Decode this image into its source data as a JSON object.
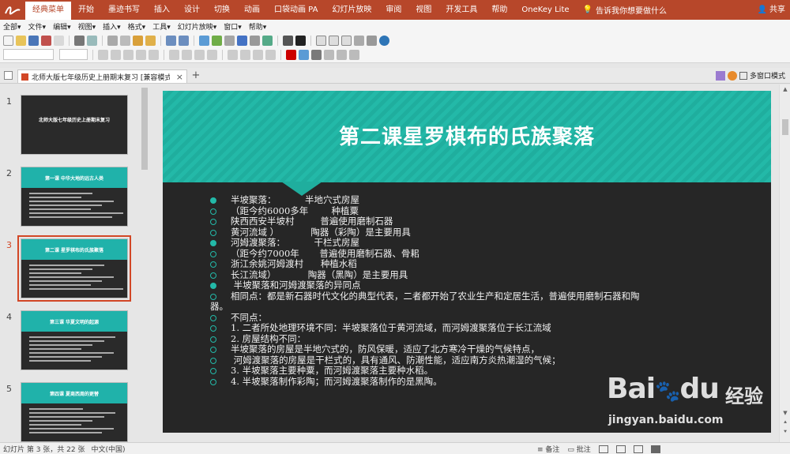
{
  "ribbon": {
    "tabs": [
      "经典菜单",
      "开始",
      "墨迹书写",
      "插入",
      "设计",
      "切换",
      "动画",
      "口袋动画 PA",
      "幻灯片放映",
      "审阅",
      "视图",
      "开发工具",
      "帮助",
      "OneKey Lite"
    ],
    "active_tab": "经典菜单",
    "tell_me": "告诉我你想要做什么",
    "share": "共享",
    "accent": "#b7472a"
  },
  "menu": {
    "items": [
      "全部▾",
      "文件▾",
      "编辑▾",
      "视图▾",
      "插入▾",
      "格式▾",
      "工具▾",
      "幻灯片放映▾",
      "窗口▾",
      "帮助▾"
    ]
  },
  "doc_tab": {
    "title": "北师大版七年级历史上册期末复习 [兼容模式",
    "close": "×",
    "plus": "+",
    "multi_window": "多窗口模式"
  },
  "thumbnails": [
    {
      "num": "1",
      "title": "北师大版七年级历史上册期末复习"
    },
    {
      "num": "2",
      "title": "第一课 中华大地的远古人类"
    },
    {
      "num": "3",
      "title": "第二课 星罗棋布的氏族聚落"
    },
    {
      "num": "4",
      "title": "第三课 华夏文明的起源"
    },
    {
      "num": "5",
      "title": "第四课 夏商西周的更替"
    }
  ],
  "slide": {
    "title": "第二课星罗棋布的氏族聚落",
    "accent": "#23b9a8",
    "lines": [
      {
        "bullet": "filled",
        "text": "半坡聚落：          半地穴式房屋"
      },
      {
        "bullet": "hollow",
        "text": "（距今约6000多年        种植粟"
      },
      {
        "bullet": "hollow",
        "text": "陕西西安半坡村         普遍使用磨制石器"
      },
      {
        "bullet": "hollow",
        "text": "黄河流域 ）           陶器（彩陶）是主要用具"
      },
      {
        "bullet": "filled",
        "text": "河姆渡聚落：          干栏式房屋"
      },
      {
        "bullet": "hollow",
        "text": "（距今约7000年       普遍使用磨制石器、骨耜"
      },
      {
        "bullet": "hollow",
        "text": "浙江余姚河姆渡村      种植水稻"
      },
      {
        "bullet": "hollow",
        "text": "长江流域）           陶器（黑陶）是主要用具"
      },
      {
        "bullet": "filled",
        "text": " 半坡聚落和河姆渡聚落的异同点"
      },
      {
        "bullet": "hollow",
        "text": "相同点：都是新石器时代文化的典型代表，二者都开始了农业生产和定居生活，普遍使用磨制石器和陶"
      },
      {
        "bullet": "none",
        "text": "器。"
      },
      {
        "bullet": "hollow",
        "text": "不同点："
      },
      {
        "bullet": "hollow",
        "text": "1. 二者所处地理环境不同：半坡聚落位于黄河流域，而河姆渡聚落位于长江流域"
      },
      {
        "bullet": "hollow",
        "text": "2. 房屋结构不同："
      },
      {
        "bullet": "hollow",
        "text": "半坡聚落的房屋是半地穴式的，防风保暖，适应了北方寒冷干燥的气候特点，"
      },
      {
        "bullet": "hollow",
        "text": " 河姆渡聚落的房屋是干栏式的，具有通风、防潮性能，适应南方炎热潮湿的气候；"
      },
      {
        "bullet": "hollow",
        "text": "3. 半坡聚落主要种粟，而河姆渡聚落主要种水稻。"
      },
      {
        "bullet": "hollow",
        "text": "4. 半坡聚落制作彩陶；而河姆渡聚落制作的是黑陶。"
      }
    ]
  },
  "status": {
    "slide_info": "幻灯片 第 3 张，共 22 张",
    "language": "中文(中国)",
    "notes": "备注",
    "comments": "批注"
  },
  "watermark": {
    "bai": "Bai",
    "du": "du",
    "jingyan": "经验",
    "url": "jingyan.baidu.com"
  }
}
